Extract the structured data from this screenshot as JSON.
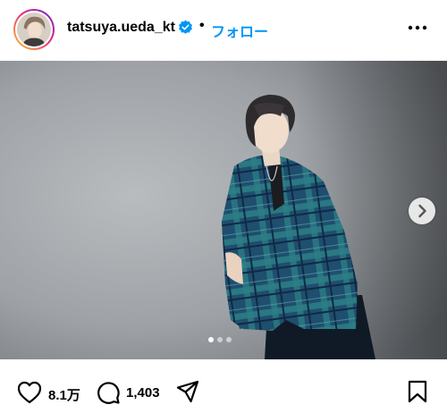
{
  "post": {
    "username": "tatsuya.ueda_kt",
    "verified": true,
    "separator": "•",
    "follow_label": "フォロー",
    "more_icon": "more-horizontal-icon"
  },
  "media": {
    "description_icon": "post-photo",
    "carousel_total": 3,
    "carousel_active": 1,
    "next_icon": "chevron-right-icon"
  },
  "actions": {
    "like_icon": "heart-icon",
    "like_count": "8.1万",
    "comment_icon": "comment-bubble-icon",
    "comment_count": "1,403",
    "share_icon": "paper-plane-icon",
    "save_icon": "bookmark-icon"
  },
  "colors": {
    "accent": "#0095f6",
    "text": "#000000",
    "background": "#ffffff"
  }
}
